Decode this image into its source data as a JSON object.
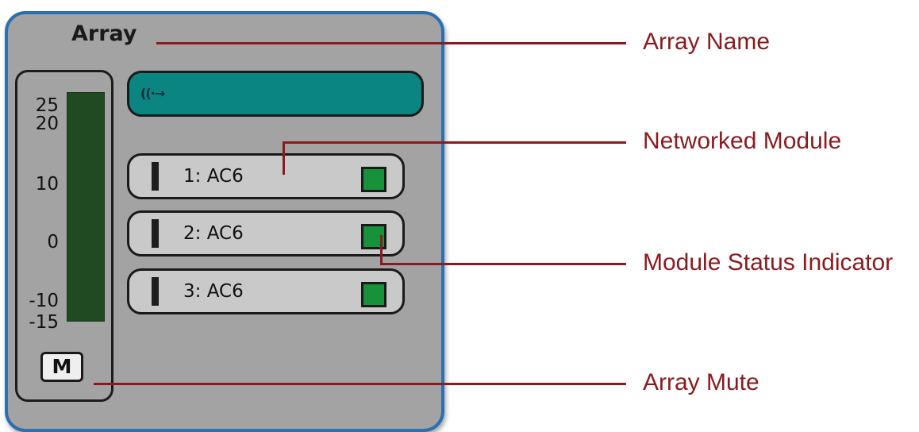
{
  "panel": {
    "title": "Array",
    "meter": {
      "ticks": [
        "25",
        "20",
        "10",
        "0",
        "-10",
        "-15"
      ],
      "bar_color": "#1f4a22"
    },
    "mute_label": "M",
    "network_bar": {
      "icon": "network-signal-icon",
      "icon_text": "((·→",
      "color": "#0b8582"
    },
    "modules": [
      {
        "label": "1: AC6",
        "status_color": "#17913a"
      },
      {
        "label": "2: AC6",
        "status_color": "#17913a"
      },
      {
        "label": "3: AC6",
        "status_color": "#17913a"
      }
    ]
  },
  "callouts": {
    "array_name": "Array Name",
    "networked_module": "Networked Module",
    "module_status_indicator": "Module Status Indicator",
    "array_mute": "Array Mute",
    "color": "#8b1a1e"
  }
}
